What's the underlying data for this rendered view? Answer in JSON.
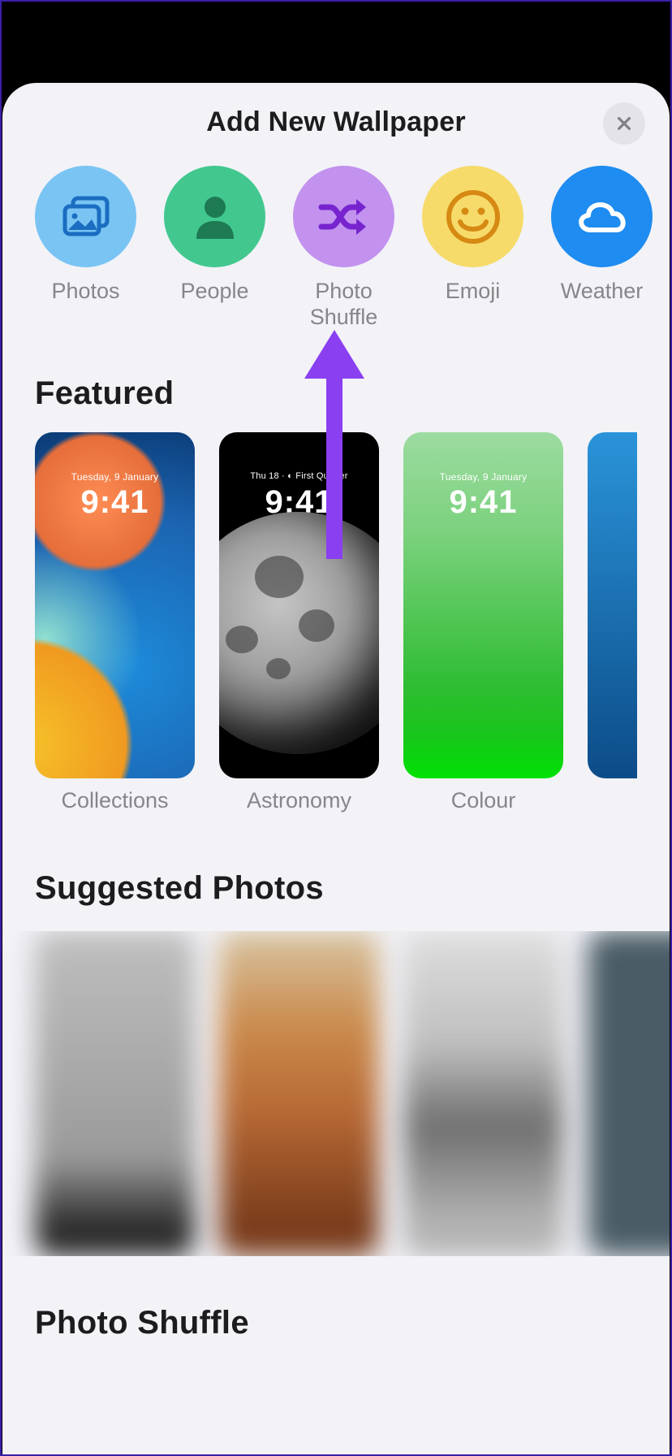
{
  "header": {
    "title": "Add New Wallpaper"
  },
  "categories": [
    {
      "id": "photos",
      "label": "Photos",
      "color": "#79c4f3",
      "icon": "photos-icon"
    },
    {
      "id": "people",
      "label": "People",
      "color": "#42c88f",
      "icon": "person-icon"
    },
    {
      "id": "shuffle",
      "label": "Photo\nShuffle",
      "color": "#c292ee",
      "icon": "shuffle-icon"
    },
    {
      "id": "emoji",
      "label": "Emoji",
      "color": "#f6db6b",
      "icon": "emoji-icon"
    },
    {
      "id": "weather",
      "label": "Weather",
      "color": "#1e8cf0",
      "icon": "weather-icon"
    }
  ],
  "featured": {
    "title": "Featured",
    "items": [
      {
        "id": "collections",
        "label": "Collections",
        "date": "Tuesday, 9 January",
        "time": "9:41"
      },
      {
        "id": "astronomy",
        "label": "Astronomy",
        "date": "Thu 18 · ◐ First Quarter",
        "time": "9:41"
      },
      {
        "id": "colour",
        "label": "Colour",
        "date": "Tuesday, 9 January",
        "time": "9:41"
      }
    ]
  },
  "suggested": {
    "title": "Suggested Photos"
  },
  "photo_shuffle": {
    "title": "Photo Shuffle"
  }
}
